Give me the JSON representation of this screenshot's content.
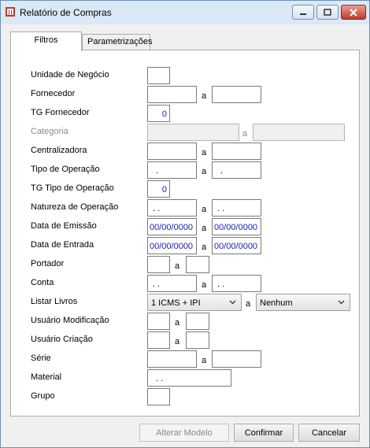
{
  "window": {
    "title": "Relatório de Compras"
  },
  "tabs": [
    {
      "label": "Filtros"
    },
    {
      "label": "Parametrizações"
    }
  ],
  "form": {
    "unidade_negocio": {
      "label": "Unidade de Negócio",
      "value": ""
    },
    "fornecedor": {
      "label": "Fornecedor",
      "sep": "a",
      "from": "",
      "to": ""
    },
    "tg_fornecedor": {
      "label": "TG Fornecedor",
      "value": "0"
    },
    "categoria": {
      "label": "Categoria",
      "sep": "a",
      "from": "",
      "to": ""
    },
    "centralizadora": {
      "label": "Centralizadora",
      "sep": "a",
      "from": "",
      "to": ""
    },
    "tipo_operacao": {
      "label": "Tipo de Operação",
      "sep": "a",
      "from": ".",
      "to": "."
    },
    "tg_tipo_operacao": {
      "label": "TG Tipo de Operação",
      "value": "0"
    },
    "natureza_operacao": {
      "label": "Natureza de Operação",
      "sep": "a",
      "from": ". .",
      "to": ". ."
    },
    "data_emissao": {
      "label": "Data de Emissão",
      "sep": "a",
      "from": "00/00/0000",
      "to": "00/00/0000"
    },
    "data_entrada": {
      "label": "Data de Entrada",
      "sep": "a",
      "from": "00/00/0000",
      "to": "00/00/0000"
    },
    "portador": {
      "label": "Portador",
      "sep": "a",
      "from": "",
      "to": ""
    },
    "conta": {
      "label": "Conta",
      "sep": "a",
      "from": ". .",
      "to": ". ."
    },
    "listar_livros": {
      "label": "Listar Livros",
      "sep": "a",
      "from": "1 ICMS + IPI",
      "to": "Nenhum"
    },
    "usuario_modificacao": {
      "label": "Usuário Modificação",
      "sep": "a",
      "from": "",
      "to": ""
    },
    "usuario_criacao": {
      "label": "Usuário Criação",
      "sep": "a",
      "from": "",
      "to": ""
    },
    "serie": {
      "label": "Série",
      "sep": "a",
      "from": "",
      "to": ""
    },
    "material": {
      "label": "Material",
      "value": ". ."
    },
    "grupo": {
      "label": "Grupo",
      "value": ""
    }
  },
  "buttons": {
    "alterar_modelo": "Alterar Modelo",
    "confirmar": "Confirmar",
    "cancelar": "Cancelar"
  },
  "colors": {
    "titlebar": "#dbe8f6",
    "value_text": "#1a1ab5",
    "close_button": "#c0392b"
  }
}
